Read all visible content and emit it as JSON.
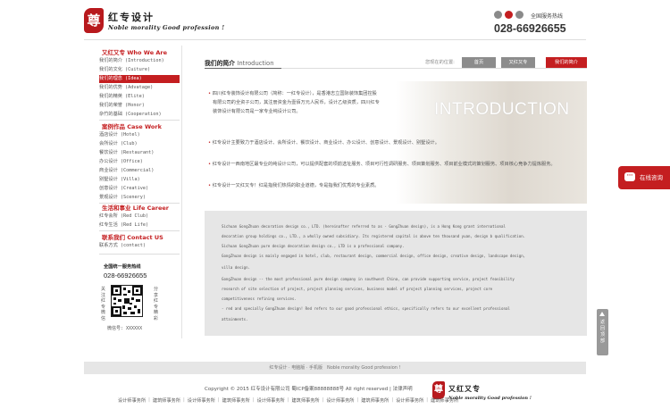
{
  "header": {
    "logo_seal": "尊",
    "logo_cn": "红专设计",
    "logo_en": "Noble morality Good profession !",
    "hotline_label": "全国服务热线",
    "hotline_number": "028-66926655",
    "social_colors": [
      "#8a8a8a",
      "#c41e20",
      "#8a8a8a"
    ]
  },
  "sidebar": {
    "sections": [
      {
        "title": "又红又专 Who We Are",
        "items": [
          "我们的简介 (Introduction)",
          "我们的文化 (Cuiture)",
          "我们的理念 (Idea)",
          "我们的优势 (Advatage)",
          "我们的精英 (Elite)",
          "我们的荣誉 (Honor)",
          "杂竹的基础 (Cooperation)"
        ]
      },
      {
        "title": "案例作品 Case Work",
        "items": [
          "酒店设计 (Hotel)",
          "会所设计 (Club)",
          "餐饮设计 (Restaurant)",
          "办公设计 (Office)",
          "商业设计 (Commercial)",
          "别墅设计 (Villa)",
          "创意设计 (Creative)",
          "景观设计 (Scenery)"
        ]
      },
      {
        "title": "生活和事业 Life Career",
        "items": [
          "红专会所 (Red Club)",
          "红专生活 (Red Life)"
        ]
      },
      {
        "title": "联系我们 Contact US",
        "items": [
          "联系方式 (contact)"
        ]
      }
    ],
    "active_item": "我们的理念 (Idea)",
    "phone_label": "全国统一服务热线",
    "phone": "028-66926655",
    "qr_left_text": "关注红专微信",
    "qr_right_text": "分享红专精彩",
    "wechat": "微信号: XXXXXX"
  },
  "main": {
    "title_cn": "我们的简介",
    "title_en": "Introduction",
    "location_label": "您现在的位置:",
    "breadcrumbs": [
      "首页",
      "又红又专",
      "我们的简介"
    ],
    "banner": "INTRODUCTION",
    "paragraphs": [
      [
        "四川红专装饰设计有限公司（简称：一红专设计），是香港志立国际装饰集团控股",
        "有限公司的全资子公司，其注册资金为壹佰万元人民币，设计乙级资质，四川红专",
        "装饰设计有限公司是一家专业纯设计公司。"
      ],
      [
        "红专设计主要致力于酒店设计、会所设计、餐饮设计、商业设计、办公设计、创意设计、景观设计、别墅设计。"
      ],
      [
        "红专设计一西南地区最专业的纯设计公司，可以提供配套的项前选址服务、项目可行性调研服务、项目策划服务、项目前业模式的策划服务、项目核心竞争力提炼服务。"
      ],
      [
        "红专设计一又红又专！红是指我们热情的职业道德，专是指我们优秀的专业素质。"
      ]
    ],
    "english_lines": [
      "Sichuan GongZhuan decoration design co., LTD. (hereinafter referred to as - GongZhuan design), is a Hong Kong grant international",
      "decoration group holdings co., LTD., a wholly owned subsidiary. Its registered capital is above ten thousand yuan, design b qualification.",
      "Sichuan GongZhuan pure design decoration design co., LTD is a professional company.",
      "GongZhuan design is mainly engaged in hotel, club, restaurant design, commercial design, office design, creative design, landscape design,",
      "villa design.",
      "GongZhuan design -- the most professional pure design company in southwest China, can provide supporting service, project feasibility",
      "research of site selection of project, project planning services, business model of project planning services, project core",
      "competitiveness refining services.",
      "- red and specially GongZhuan design! Red refers to our good professional ethics, specifically refers to our excellent professional",
      "attainments."
    ]
  },
  "floats": {
    "consult_icon": "···",
    "consult_label": "在线咨询",
    "top_label": "返回顶部"
  },
  "footer": {
    "nav_text": "红专设计 · 电脑版 · 手机版　Noble morality Good profession !",
    "copyright": "Copyright © 2015  红专设计有限公司  蜀ICP备案88888888号  All right reserved | 法律声明",
    "links": [
      "设计师事务所",
      "建筑师事务所",
      "设计师事务所",
      "建筑师事务所",
      "设计师事务所",
      "建筑师事务所",
      "设计师事务所",
      "建筑师事务所",
      "设计师事务所",
      "建筑师事务所"
    ],
    "logo_seal": "尊",
    "logo_cn": "又红又专",
    "logo_en": "Noble morality Good profession !"
  },
  "colors": {
    "accent": "#c41e20",
    "crumb_gray": "#8c8c8c"
  }
}
